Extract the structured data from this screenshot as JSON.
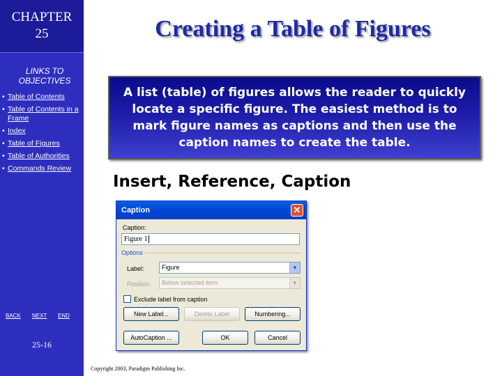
{
  "sidebar": {
    "chapter_label": "CHAPTER",
    "chapter_number": "25",
    "links_heading_line1": "LINKS TO",
    "links_heading_line2": "OBJECTIVES",
    "links": [
      {
        "label": "Table of Contents"
      },
      {
        "label": "Table of Contents in a Frame"
      },
      {
        "label": "Index"
      },
      {
        "label": "Table of Figures"
      },
      {
        "label": "Table of Authorities"
      },
      {
        "label": "Commands Review"
      }
    ],
    "nav": {
      "back": "BACK",
      "next": "NEXT",
      "end": "END"
    },
    "page_number": "25-16"
  },
  "slide": {
    "title": "Creating a Table of Figures",
    "description": "A list (table) of figures allows the reader to quickly locate a specific figure. The easiest method is to mark figure names as captions and then use the caption names to create the table.",
    "menu_path": "Insert, Reference, Caption",
    "copyright": "Copyright 2003, Paradigm Publishing Inc."
  },
  "dialog": {
    "title": "Caption",
    "close_glyph": "✕",
    "caption_label": "Caption:",
    "caption_value": "Figure 1",
    "options_label": "Options",
    "label_label": "Label:",
    "label_value": "Figure",
    "position_label": "Position:",
    "position_value": "Below selected item",
    "exclude_label": "Exclude label from caption",
    "exclude_checked": false,
    "buttons": {
      "new_label": "New Label...",
      "delete_label": "Delete Label",
      "numbering": "Numbering...",
      "autocaption": "AutoCaption ...",
      "ok": "OK",
      "cancel": "Cancel"
    }
  },
  "colors": {
    "sidebar_bg": "#2e2ebe",
    "title_color": "#1e2aa6",
    "desc_box_bg": "#1a1aa6",
    "dialog_titlebar": "#0046d5"
  }
}
